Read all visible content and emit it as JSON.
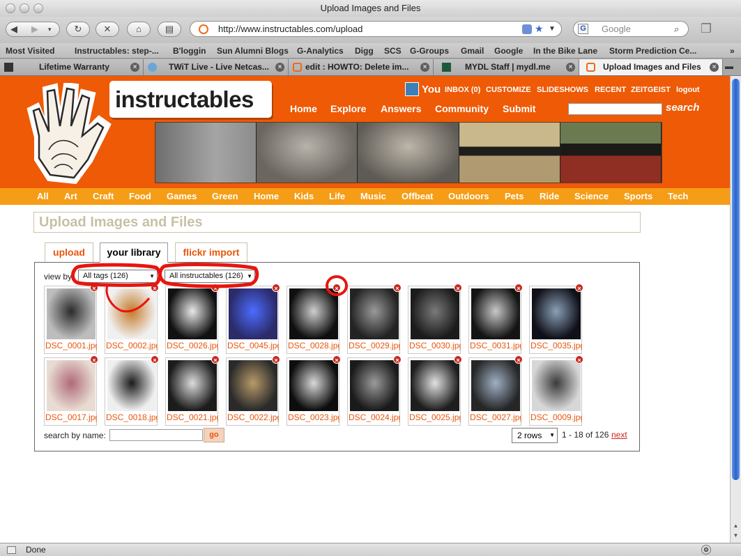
{
  "window": {
    "title": "Upload Images and Files"
  },
  "toolbar": {
    "url": "http://www.instructables.com/upload",
    "search_placeholder": "Google"
  },
  "bookmarks": [
    "Most Visited",
    "Instructables: step-...",
    "B'loggin",
    "Sun Alumni Blogs",
    "G-Analytics",
    "Digg",
    "SCS",
    "G-Groups",
    "Gmail",
    "Google",
    "In the Bike Lane",
    "Storm Prediction Ce..."
  ],
  "tabs": [
    {
      "label": "Lifetime Warranty"
    },
    {
      "label": "TWiT Live - Live Netcas..."
    },
    {
      "label": "edit : HOWTO: Delete im..."
    },
    {
      "label": "MYDL Staff | mydl.me"
    },
    {
      "label": "Upload Images and Files"
    }
  ],
  "site": {
    "logo_text": "instructables",
    "user_label": "You",
    "user_links": [
      "INBOX (0)",
      "CUSTOMIZE",
      "SLIDESHOWS",
      "RECENT",
      "ZEITGEIST",
      "logout"
    ],
    "nav": [
      "Home",
      "Explore",
      "Answers",
      "Community",
      "Submit"
    ],
    "search_label": "search",
    "categories": [
      "All",
      "Art",
      "Craft",
      "Food",
      "Games",
      "Green",
      "Home",
      "Kids",
      "Life",
      "Music",
      "Offbeat",
      "Outdoors",
      "Pets",
      "Ride",
      "Science",
      "Sports",
      "Tech"
    ]
  },
  "upload": {
    "title": "Upload Images and Files",
    "tabs": [
      "upload",
      "your library",
      "flickr import"
    ],
    "view_by_label": "view by",
    "filter_tags": "All tags (126)",
    "filter_instructables": "All instructables (126)",
    "images": [
      "DSC_0001.jpg",
      "DSC_0002.jpg",
      "DSC_0026.jpg",
      "DSC_0045.jpg",
      "DSC_0028.jpg",
      "DSC_0029.jpg",
      "DSC_0030.jpg",
      "DSC_0031.jpg",
      "DSC_0035.jpg",
      "DSC_0017.jpg",
      "DSC_0018.jpg",
      "DSC_0021.jpg",
      "DSC_0022.jpg",
      "DSC_0023.jpg",
      "DSC_0024.jpg",
      "DSC_0025.jpg",
      "DSC_0027.jpg",
      "DSC_0009.jpg"
    ],
    "search_label": "search by name:",
    "go_label": "go",
    "rows_option": "2 rows",
    "page_count": "1 - 18 of 126",
    "next_label": "next"
  },
  "status": {
    "text": "Done"
  },
  "colors": {
    "brand_orange": "#ef5a06",
    "category_bar": "#f59d16",
    "link_orange": "#e8550a",
    "annotation_red": "#e8150f"
  }
}
